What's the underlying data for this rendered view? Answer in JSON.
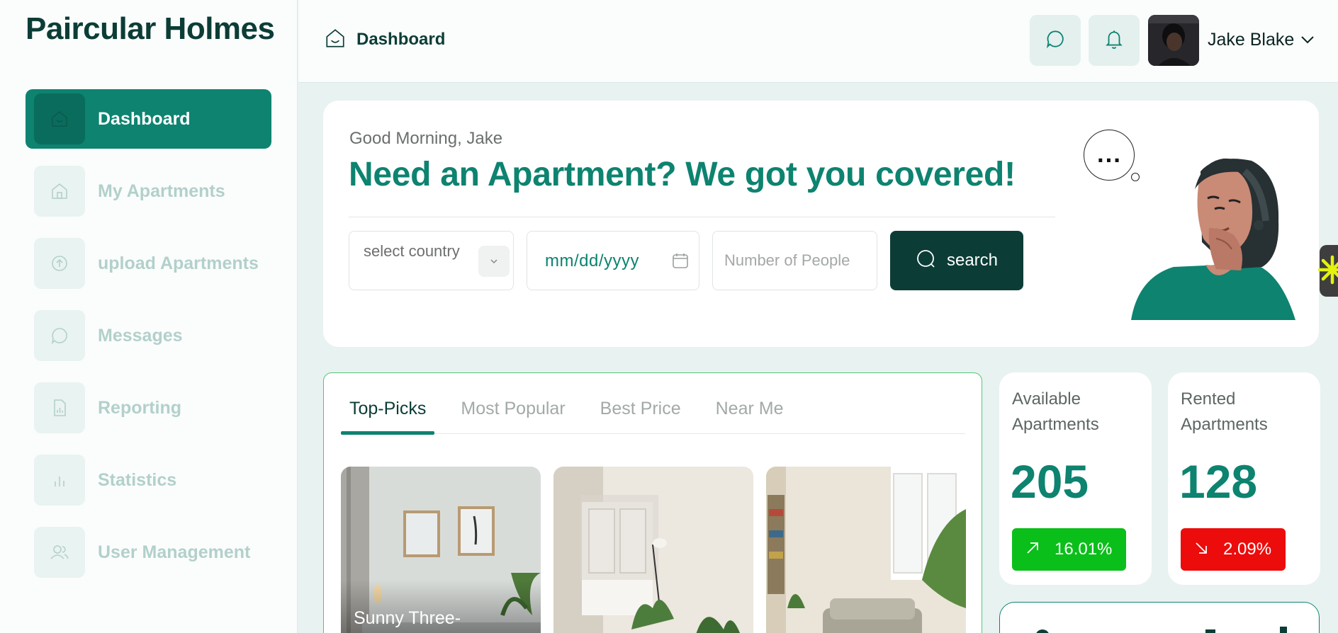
{
  "brand": {
    "name": "Paircular Holmes"
  },
  "sidebar": {
    "items": [
      {
        "label": "Dashboard",
        "icon": "home-icon",
        "active": true
      },
      {
        "label": "My Apartments",
        "icon": "house-icon",
        "active": false
      },
      {
        "label": "upload Apartments",
        "icon": "upload-icon",
        "active": false
      },
      {
        "label": "Messages",
        "icon": "chat-icon",
        "active": false
      },
      {
        "label": "Reporting",
        "icon": "report-icon",
        "active": false
      },
      {
        "label": "Statistics",
        "icon": "bar-chart-icon",
        "active": false
      },
      {
        "label": "User Management",
        "icon": "users-icon",
        "active": false
      }
    ]
  },
  "header": {
    "breadcrumb": "Dashboard",
    "icons": [
      "chat-icon",
      "bell-icon"
    ],
    "user": {
      "name": "Jake Blake"
    }
  },
  "hero": {
    "greeting": "Good Morning, Jake",
    "headline": "Need an Apartment? We got you covered!",
    "country_placeholder": "select country",
    "date_placeholder": "mm/dd/yyyy",
    "people_placeholder": "Number of People",
    "search_label": "search",
    "thought_bubble": "..."
  },
  "tabs": [
    "Top-Picks",
    "Most Popular",
    "Best Price",
    "Near Me"
  ],
  "listings": [
    {
      "title": "Sunny Three-"
    },
    {
      "title": ""
    },
    {
      "title": ""
    }
  ],
  "stats": [
    {
      "label": "Available Apartments",
      "value": "205",
      "change": "16.01%",
      "trend": "up",
      "color": "#0bbf1a"
    },
    {
      "label": "Rented Apartments",
      "value": "128",
      "change": "2.09%",
      "trend": "down",
      "color": "#ec0c0c"
    }
  ],
  "colors": {
    "brand": "#0d8370",
    "dark": "#0b3d36",
    "background": "#e8f2f0"
  }
}
